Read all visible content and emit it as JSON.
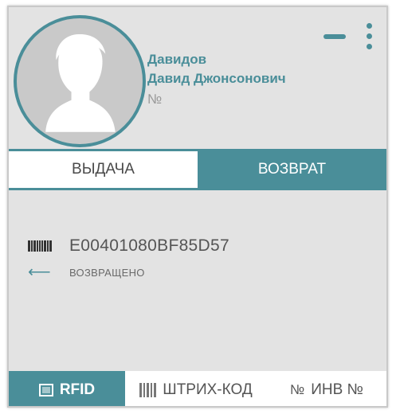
{
  "user": {
    "last_name": "Давидов",
    "first_middle_name": "Давид Джонсонович",
    "number_label": "№"
  },
  "header": {
    "minimize_icon": "minimize-icon",
    "menu_icon": "vertical-dots-icon"
  },
  "tabs": [
    {
      "label": "ВЫДАЧА",
      "active": false
    },
    {
      "label": "ВОЗВРАТ",
      "active": true
    }
  ],
  "item": {
    "code": "E00401080BF85D57",
    "status": "ВОЗВРАЩЕНО",
    "code_icon": "barcode-icon",
    "status_icon": "arrow-left-icon"
  },
  "footer": {
    "tabs": [
      {
        "label": "RFID",
        "icon": "rfid-icon",
        "active": true
      },
      {
        "label": "ШТРИХ-КОД",
        "icon": "barcode-icon",
        "active": false
      },
      {
        "label": "ИНВ №",
        "icon": "number-icon",
        "icon_text": "№",
        "active": false
      }
    ]
  },
  "colors": {
    "accent": "#4a8e99",
    "panel": "#e3e3e3",
    "white": "#ffffff"
  }
}
